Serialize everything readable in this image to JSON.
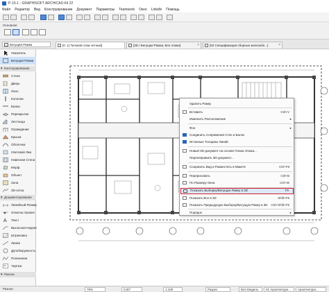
{
  "window": {
    "title": "Р-10-1 - GRAPHISOFT ARCHICAD-64 22"
  },
  "menu": [
    "Файл",
    "Редактор",
    "Вид",
    "Конструирование",
    "Документ",
    "Параметры",
    "Teamwork",
    "Окно",
    "Linkdlv",
    "Помощь"
  ],
  "info_box": {
    "label": "Основная"
  },
  "tabs": {
    "nav_label": "Бегущая Рамка",
    "items": [
      {
        "label": "[0. 1] Типовой этаж четный]"
      },
      {
        "label": "[3D / Бегущая Рамка, Все этажи]"
      },
      {
        "label": "[02 Спецификация сборных железобе...]"
      }
    ]
  },
  "sidebar": {
    "pointer": "Указатель",
    "marquee": "Бегущая Рамка",
    "section_design": "Конструирование",
    "design_items": [
      "Стена",
      "Дверь",
      "Окно",
      "Колонна",
      "Балка",
      "Перекрытие",
      "Лестница",
      "Ограждение",
      "Крыша",
      "Оболочка",
      "Световой Люк",
      "Навесная Стена",
      "Морф",
      "Объект",
      "Зона",
      "3D-сетка"
    ],
    "section_doc": "Документирование",
    "doc_items": [
      "Линейный Размер",
      "Отметка Уровня",
      "Текст",
      "Выносная Надпись",
      "Штриховка",
      "Линия",
      "Дуга/Окружность",
      "Полилиния",
      "Чертеж"
    ],
    "more": "Разное"
  },
  "context_menu": {
    "items": [
      {
        "label": "Удалить Рамку",
        "shortcut": ""
      },
      {
        "label": "Вставить",
        "shortcut": "Ctrl+V"
      },
      {
        "label": "Изменить Расположение",
        "shortcut": "",
        "submenu": true
      },
      {
        "label": "Фон",
        "shortcut": "",
        "submenu": true
      },
      {
        "label": "Соединить Сопряжения Стен и Балок",
        "shortcut": ""
      },
      {
        "label": "Истинные Толщины Линий",
        "shortcut": ""
      },
      {
        "label": "Новый 3D-документ на основе Плана Этажа...",
        "shortcut": ""
      },
      {
        "label": "Перенаправить 3D-документ...",
        "shortcut": ""
      },
      {
        "label": "Сохранить Вид и Разместить в Макете",
        "shortcut": "Ctrl+F8"
      },
      {
        "label": "Перерисовать",
        "shortcut": "Ctrl+B"
      },
      {
        "label": "По Размеру Окна",
        "shortcut": "Ctrl+W"
      },
      {
        "label": "Показать Выборку/Бегущую Рамку в 3D",
        "shortcut": "F5"
      },
      {
        "label": "Показать Все в 3D",
        "shortcut": "Shift+F5"
      },
      {
        "label": "Показать Предыдущую Выборку/Бегущую Рамку в 3D",
        "shortcut": "Ctrl+Shift+F5"
      },
      {
        "label": "Порядок",
        "shortcut": "",
        "submenu": true
      }
    ]
  },
  "status": {
    "undo_info": "",
    "zoom": "79%",
    "angle": "0,00°",
    "scale": "1:100",
    "layers": "Разрез",
    "model": "Вся Модель",
    "structure": "01 Архитектурн...",
    "pen": "Архитектурн...",
    "left_footer": "Разное"
  },
  "colors": {
    "accent": "#2a63b8",
    "highlight_border": "#d01e2e",
    "highlight_bg": "#dce9f8"
  }
}
